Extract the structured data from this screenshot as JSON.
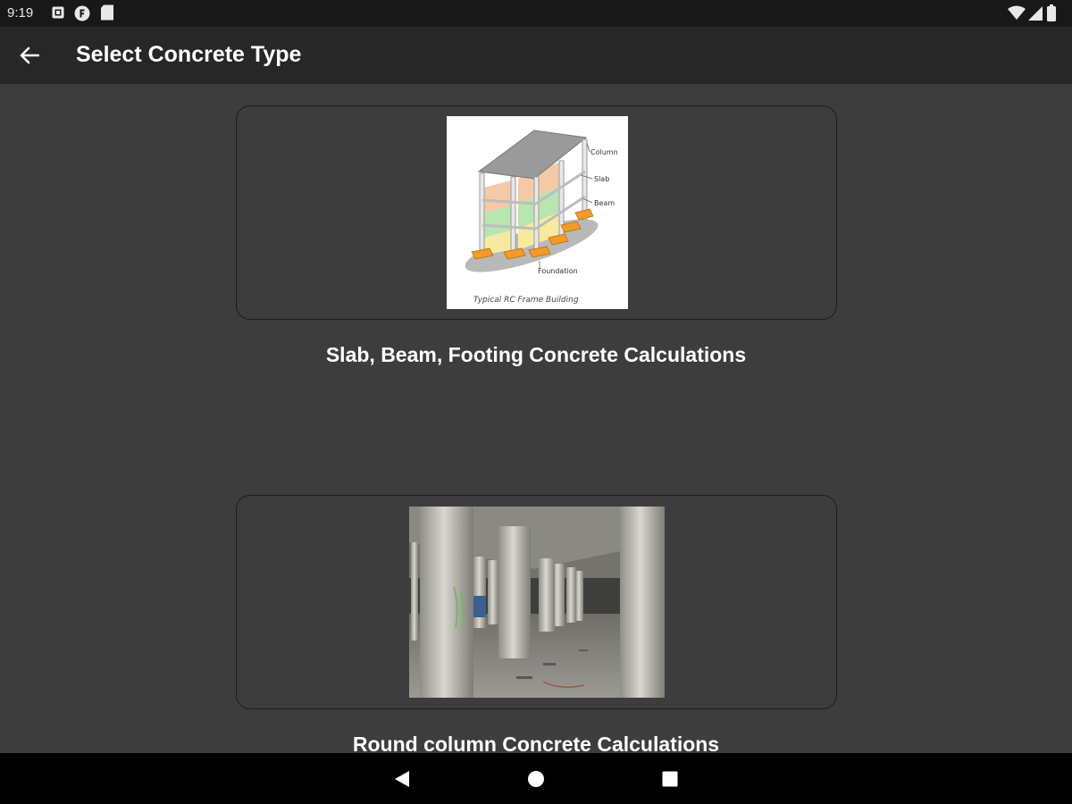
{
  "status_bar": {
    "time": "9:19",
    "icons": [
      "notification-a-icon",
      "notification-f-icon",
      "sd-card-icon",
      "wifi-icon",
      "signal-icon",
      "battery-icon"
    ]
  },
  "app_bar": {
    "title": "Select Concrete Type",
    "back_icon": "arrow-left-icon"
  },
  "cards": [
    {
      "caption": "Slab, Beam, Footing Concrete Calculations",
      "image": {
        "labels": {
          "column": "Column",
          "slab": "Slab",
          "beam": "Beam",
          "foundation": "Foundation",
          "title": "Typical RC Frame Building"
        }
      }
    },
    {
      "caption": "Round column Concrete Calculations"
    }
  ],
  "nav_bar": {
    "icons": [
      "back-triangle-icon",
      "home-circle-icon",
      "recents-square-icon"
    ]
  },
  "colors": {
    "background": "#3d3d3d",
    "app_bar": "#272727",
    "status_bar": "#181818",
    "nav_bar": "#000000",
    "text": "#ffffff"
  }
}
